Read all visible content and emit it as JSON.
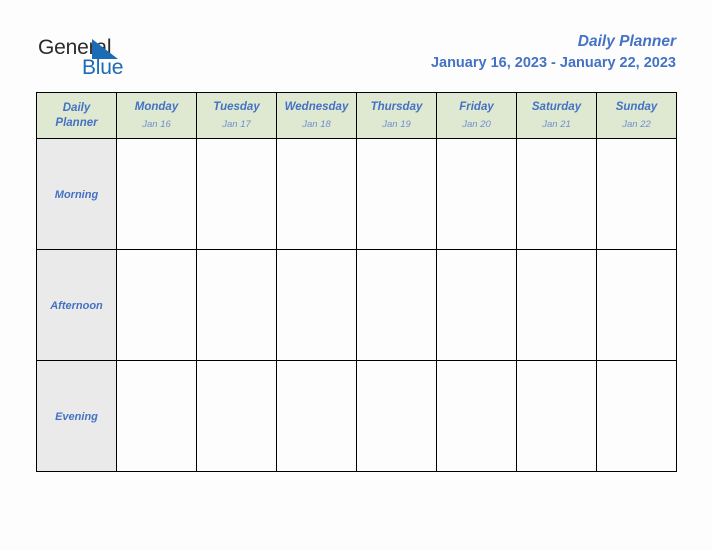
{
  "brand": {
    "name_part1": "General",
    "name_part2": "Blue",
    "triangle_icon": "blue-triangle-icon",
    "color_dark": "#2b2b2b",
    "color_blue": "#1b6cb5"
  },
  "header": {
    "title": "Daily Planner",
    "date_range": "January 16, 2023 - January 22, 2023",
    "title_color": "#4472c4"
  },
  "table": {
    "corner": {
      "line1": "Daily",
      "line2": "Planner"
    },
    "header_bg": "#dfe8d1",
    "row_label_bg": "#eaeaea",
    "border_color": "#000000",
    "days": [
      {
        "name": "Monday",
        "date": "Jan 16"
      },
      {
        "name": "Tuesday",
        "date": "Jan 17"
      },
      {
        "name": "Wednesday",
        "date": "Jan 18"
      },
      {
        "name": "Thursday",
        "date": "Jan 19"
      },
      {
        "name": "Friday",
        "date": "Jan 20"
      },
      {
        "name": "Saturday",
        "date": "Jan 21"
      },
      {
        "name": "Sunday",
        "date": "Jan 22"
      }
    ],
    "rows": [
      {
        "label": "Morning",
        "cells": [
          "",
          "",
          "",
          "",
          "",
          "",
          ""
        ]
      },
      {
        "label": "Afternoon",
        "cells": [
          "",
          "",
          "",
          "",
          "",
          "",
          ""
        ]
      },
      {
        "label": "Evening",
        "cells": [
          "",
          "",
          "",
          "",
          "",
          "",
          ""
        ]
      }
    ]
  }
}
